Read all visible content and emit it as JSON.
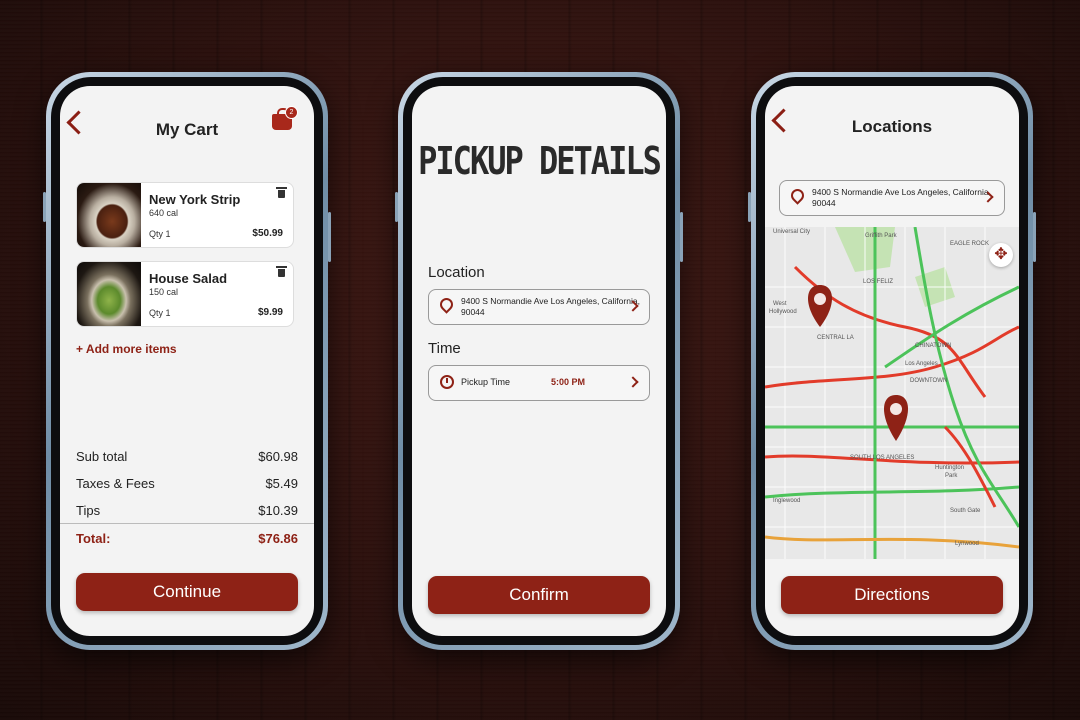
{
  "cart": {
    "title": "My Cart",
    "badge": "2",
    "items": [
      {
        "name": "New York Strip",
        "cal": "640 cal",
        "qty": "Qty 1",
        "price": "$50.99"
      },
      {
        "name": "House Salad",
        "cal": "150 cal",
        "qty": "Qty 1",
        "price": "$9.99"
      }
    ],
    "add_more": "+ Add more items",
    "summary": {
      "subtotal_label": "Sub total",
      "subtotal": "$60.98",
      "tax_label": "Taxes & Fees",
      "tax": "$5.49",
      "tips_label": "Tips",
      "tips": "$10.39",
      "total_label": "Total:",
      "total": "$76.86"
    },
    "continue": "Continue"
  },
  "pickup": {
    "title": "PICKUP DETAILS",
    "location_label": "Location",
    "address": "9400 S Normandie Ave Los Angeles, California, 90044",
    "time_label": "Time",
    "pickup_time_label": "Pickup Time",
    "pickup_time": "5:00 PM",
    "confirm": "Confirm"
  },
  "locations": {
    "title": "Locations",
    "address": "9400 S Normandie Ave Los Angeles, California, 90044",
    "map_labels": [
      "Griffith Park",
      "Universal City",
      "EAGLE ROCK",
      "LOS FELIZ",
      "West Hollywood",
      "CENTRAL LA",
      "Los Angeles",
      "DOWNTOWN",
      "CHINATOWN",
      "SOUTH LOS ANGELES",
      "Huntington Park",
      "Inglewood",
      "South Gate",
      "Lynwood"
    ],
    "directions": "Directions"
  },
  "colors": {
    "accent": "#8e2216",
    "screen": "#f3f3f3"
  }
}
